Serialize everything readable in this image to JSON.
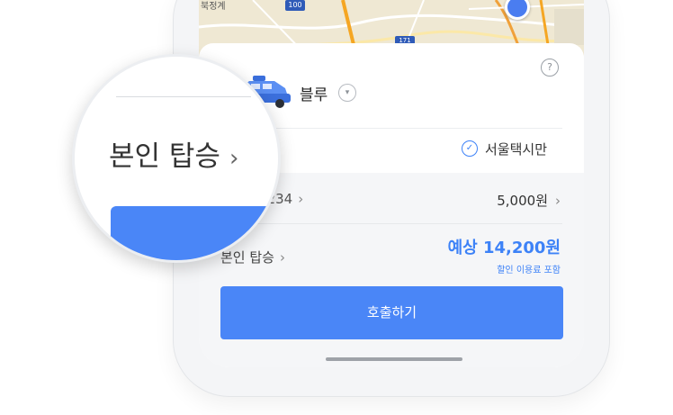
{
  "map": {
    "place_label": "북정계",
    "road_badge_1": "100",
    "road_badge_2": "171"
  },
  "sheet": {
    "help_icon": "?",
    "taxi_type": "블루",
    "type_chevron_icon": "chevron-down-icon",
    "seoul_only_label": "서울택시만",
    "card_number": "1234",
    "card_chevron": "›",
    "fare": "5,000원",
    "fare_chevron": "›",
    "ride_self": "본인 탑승",
    "ride_self_chevron": "›",
    "estimate": "예상 14,200원",
    "discount_note": "할인 이용료 포함",
    "call_button": "호출하기"
  },
  "magnifier": {
    "text": "본인 탑승",
    "chevron": "›"
  },
  "colors": {
    "accent": "#4a86f7",
    "estimate_blue": "#3d82f7"
  }
}
